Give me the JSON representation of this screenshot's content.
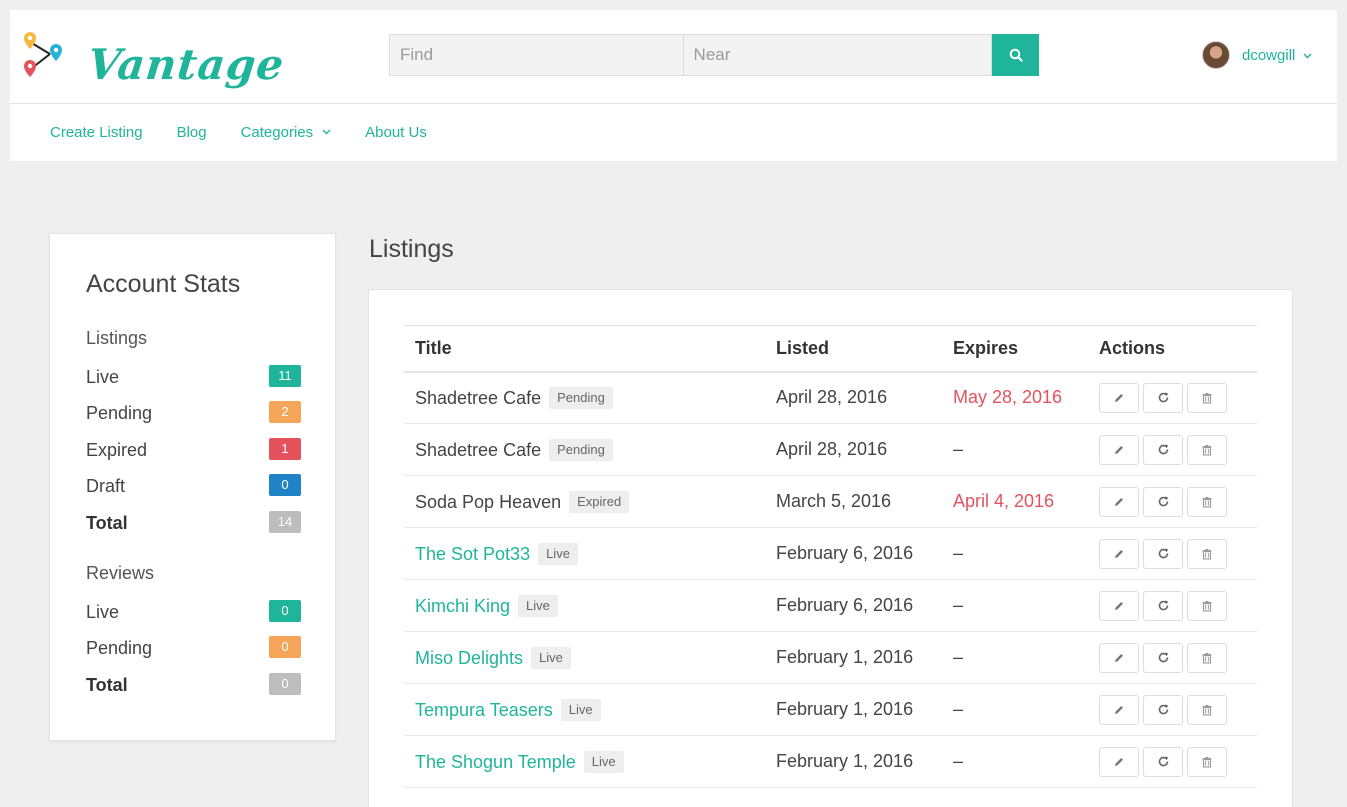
{
  "brand": {
    "name": "Vantage",
    "accent": "#1fb59a"
  },
  "search": {
    "find_placeholder": "Find",
    "near_placeholder": "Near",
    "button_icon": "search-icon"
  },
  "user": {
    "name": "dcowgill"
  },
  "nav": {
    "items": [
      "Create Listing",
      "Blog",
      "Categories",
      "About Us"
    ]
  },
  "stats": {
    "title": "Account Stats",
    "listings": {
      "heading": "Listings",
      "rows": [
        {
          "label": "Live",
          "count": "11",
          "color": "#1fb59a"
        },
        {
          "label": "Pending",
          "count": "2",
          "color": "#f5a55a"
        },
        {
          "label": "Expired",
          "count": "1",
          "color": "#e5525e"
        },
        {
          "label": "Draft",
          "count": "0",
          "color": "#1f83c5"
        },
        {
          "label": "Total",
          "count": "14",
          "color": "#bdbdbd"
        }
      ]
    },
    "reviews": {
      "heading": "Reviews",
      "rows": [
        {
          "label": "Live",
          "count": "0",
          "color": "#1fb59a"
        },
        {
          "label": "Pending",
          "count": "0",
          "color": "#f5a55a"
        },
        {
          "label": "Total",
          "count": "0",
          "color": "#bdbdbd"
        }
      ]
    }
  },
  "listings": {
    "title": "Listings",
    "columns": [
      "Title",
      "Listed",
      "Expires",
      "Actions"
    ],
    "rows": [
      {
        "title": "Shadetree Cafe",
        "status": "Pending",
        "listed": "April 28, 2016",
        "expires": "May 28, 2016",
        "expires_red": true,
        "link": false
      },
      {
        "title": "Shadetree Cafe",
        "status": "Pending",
        "listed": "April 28, 2016",
        "expires": "–",
        "expires_red": false,
        "link": false
      },
      {
        "title": "Soda Pop Heaven",
        "status": "Expired",
        "listed": "March 5, 2016",
        "expires": "April 4, 2016",
        "expires_red": true,
        "link": false
      },
      {
        "title": "The Sot Pot33",
        "status": "Live",
        "listed": "February 6, 2016",
        "expires": "–",
        "expires_red": false,
        "link": true
      },
      {
        "title": "Kimchi King",
        "status": "Live",
        "listed": "February 6, 2016",
        "expires": "–",
        "expires_red": false,
        "link": true
      },
      {
        "title": "Miso Delights",
        "status": "Live",
        "listed": "February 1, 2016",
        "expires": "–",
        "expires_red": false,
        "link": true
      },
      {
        "title": "Tempura Teasers",
        "status": "Live",
        "listed": "February 1, 2016",
        "expires": "–",
        "expires_red": false,
        "link": true
      },
      {
        "title": "The Shogun Temple",
        "status": "Live",
        "listed": "February 1, 2016",
        "expires": "–",
        "expires_red": false,
        "link": true
      }
    ],
    "action_icons": [
      "pencil-icon",
      "refresh-icon",
      "trash-icon"
    ]
  }
}
